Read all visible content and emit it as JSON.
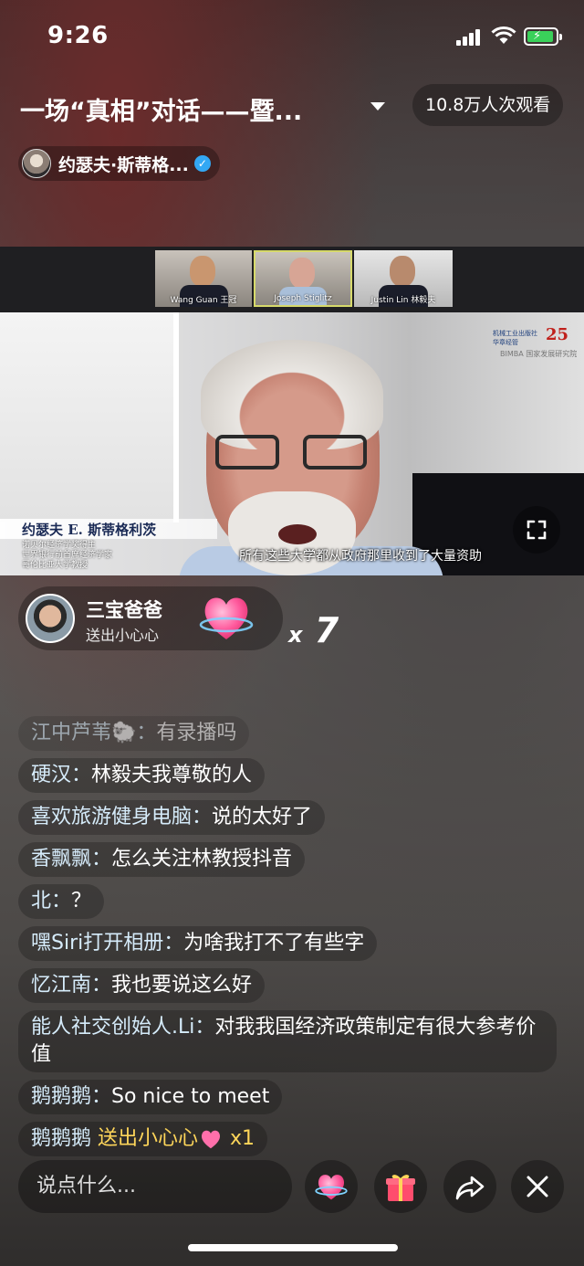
{
  "status_bar": {
    "time": "9:26"
  },
  "header": {
    "title": "一场“真相”对话——暨...",
    "viewers": "10.8万人次观看",
    "host_name": "约瑟夫·斯蒂格..."
  },
  "video": {
    "participants": [
      {
        "caption": "Wang Guan 王冠"
      },
      {
        "caption": "Joseph Stiglitz"
      },
      {
        "caption": "Justin Lin 林毅夫"
      }
    ],
    "logo_text": "机械工业出版社 华章经管",
    "logo_number": "25",
    "logo_sub": "BIMBA 国家发展研究院",
    "lower_third_name": "约瑟夫 E. 斯蒂格利茨",
    "lower_third_title_1": "诺贝尔经济学奖得主",
    "lower_third_title_2": "世界银行前首席经济学家",
    "lower_third_title_3": "哥伦比亚大学教授",
    "subtitle": "所有这些大学都从政府那里收到了大量资助"
  },
  "gift_banner": {
    "user": "三宝爸爸",
    "description": "送出小心心",
    "count_prefix": "x",
    "count": "7"
  },
  "chat": {
    "messages": [
      {
        "user": "江中芦苇🐑：",
        "text": "有录播吗"
      },
      {
        "user": "硬汉：",
        "text": "林毅夫我尊敬的人"
      },
      {
        "user": "喜欢旅游健身电脑：",
        "text": "说的太好了"
      },
      {
        "user": "香飘飘：",
        "text": "怎么关注林教授抖音"
      },
      {
        "user": "北：",
        "text": "？"
      },
      {
        "user": "嘿Siri打开相册：",
        "text": "为啥我打不了有些字"
      },
      {
        "user": "忆江南：",
        "text": "我也要说这么好"
      },
      {
        "user": "能人社交创始人.Li：",
        "text": "对我我国经济政策制定有很大参考价值"
      },
      {
        "user": "鹅鹅鹅：",
        "text": "So nice to meet"
      }
    ],
    "gift_message": {
      "user": "鹅鹅鹅",
      "action": "送出小心心",
      "count": "x1"
    }
  },
  "bottom_bar": {
    "input_placeholder": "说点什么..."
  },
  "colors": {
    "verified": "#33a8f4",
    "gift_text": "#ffd65a",
    "username": "#d6ecfb",
    "battery": "#3ad15a",
    "heart": "#ff5a9d"
  }
}
